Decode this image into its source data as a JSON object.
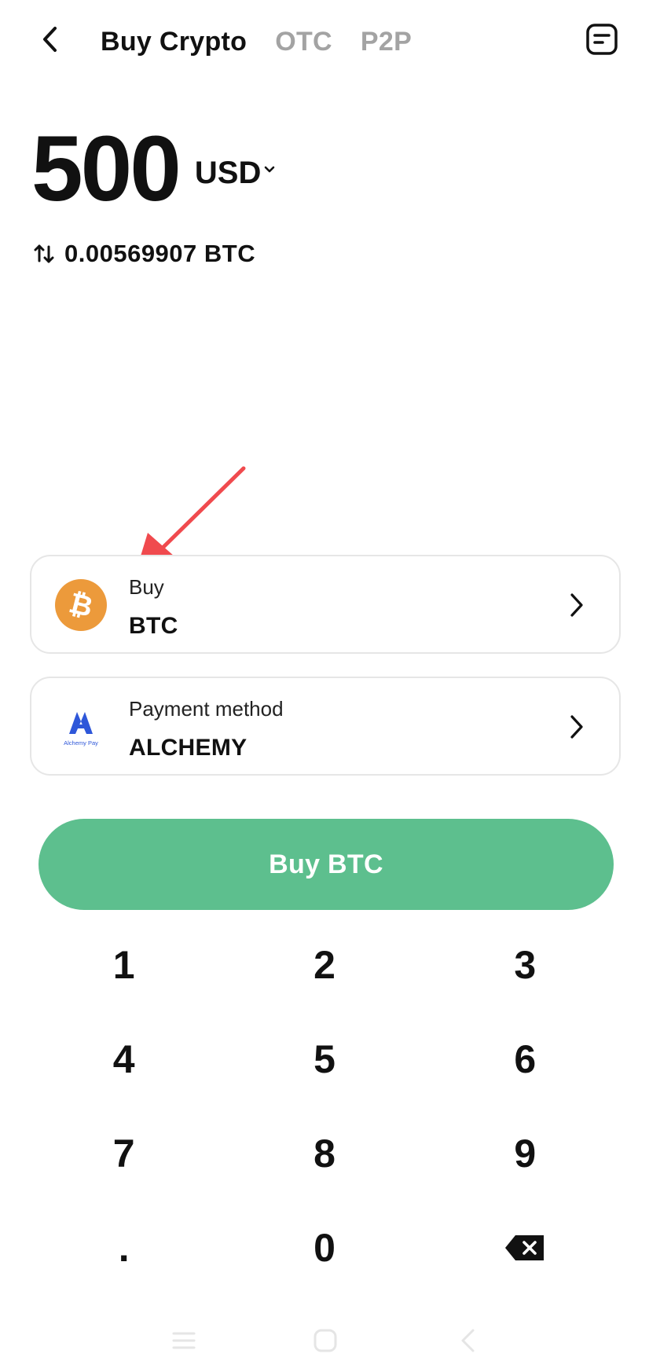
{
  "header": {
    "tabs": [
      {
        "label": "Buy Crypto",
        "active": true
      },
      {
        "label": "OTC",
        "active": false
      },
      {
        "label": "P2P",
        "active": false
      }
    ],
    "back_icon": "chevron-left-icon",
    "orders_icon": "order-list-icon"
  },
  "amount": {
    "value": "500",
    "currency": "USD",
    "converted": "0.00569907 BTC",
    "swap_icon": "swap-arrows-icon"
  },
  "cards": {
    "asset": {
      "label": "Buy",
      "value": "BTC",
      "icon": "bitcoin-icon"
    },
    "payment": {
      "label": "Payment method",
      "value": "ALCHEMY",
      "icon": "alchemy-pay-logo-icon",
      "logo_text": "Alchemy Pay"
    }
  },
  "buy_button": {
    "label": "Buy BTC"
  },
  "keypad": {
    "keys": [
      "1",
      "2",
      "3",
      "4",
      "5",
      "6",
      "7",
      "8",
      "9",
      ".",
      "0"
    ],
    "delete_icon": "backspace-icon"
  },
  "colors": {
    "accent_green": "#5dbf8e",
    "bitcoin_orange": "#ec9a3b",
    "alchemy_blue": "#2e57d9",
    "annotation_red": "#f04a4e",
    "inactive_tab": "#a3a3a3"
  }
}
